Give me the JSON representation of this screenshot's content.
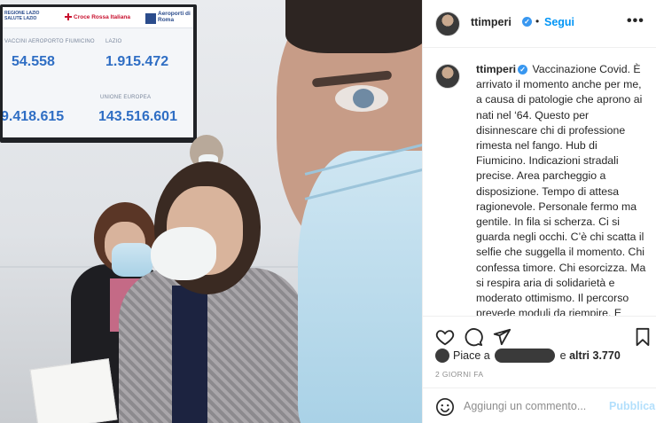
{
  "photo": {
    "screen": {
      "header_lazio": "REGIONE LAZIO",
      "header_health": "SALUTE LAZIO",
      "header_cri": "Croce Rossa Italiana",
      "header_adr": "Aeroporti di Roma",
      "label_fiumicino": "VACCINI AEROPORTO FIUMICINO",
      "label_lazio": "LAZIO",
      "label_ue": "UNIONE EUROPEA",
      "num_fiumicino": "54.558",
      "num_lazio": "1.915.472",
      "num_left_bottom": "9.418.615",
      "num_ue": "143.516.601"
    }
  },
  "header": {
    "username": "ttimperi",
    "separator": "•",
    "follow_label": "Segui",
    "more_label": "•••"
  },
  "caption": {
    "username": "ttimperi",
    "text": "Vaccinazione Covid. È arrivato il momento anche per me, a causa di patologie che aprono ai nati nel ‘64. Questo per disinnescare chi di professione rimesta nel fango. Hub di Fiumicino. Indicazioni stradali precise. Area parcheggio a disposizione. Tempo di attesa ragionevole. Personale fermo ma gentile. In fila si scherza. Ci si guarda negli occhi. C’è chi scatta il selfie che suggella il momento. Chi confessa timore. Chi esorcizza. Ma si respira aria di solidarietà e moderato ottimismo. Il percorso prevede moduli da riempire. E l’angoscia della penna toccata chissà da chi, si smorza davanti al disinfettante a portata di mano. Braccialetto verde per un membro. Rifaccio che dove..."
  },
  "likes": {
    "prefix": "Piace a",
    "middle": "e",
    "suffix": "altri 3.770"
  },
  "time_label": "2 GIORNI FA",
  "comment": {
    "placeholder": "Aggiungi un commento...",
    "publish_label": "Pubblica"
  },
  "icons": {
    "like": "heart-icon",
    "comment": "comment-icon",
    "share": "paper-plane-icon",
    "save": "bookmark-icon",
    "emoji": "emoji-icon"
  },
  "colors": {
    "accent": "#0095f6",
    "verified": "#3897f0",
    "publish_disabled": "#b2dffc",
    "muted": "#8e8e8e"
  }
}
